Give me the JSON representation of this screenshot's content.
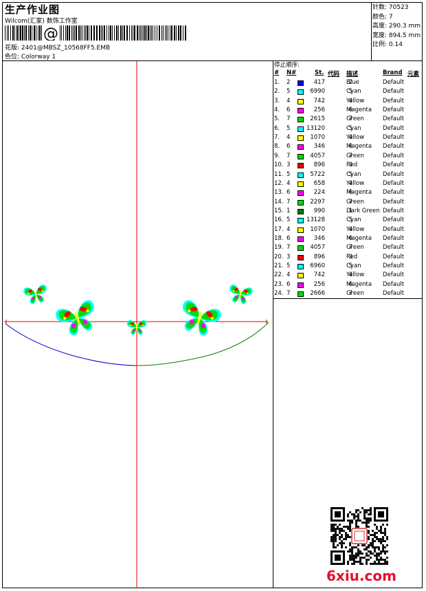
{
  "header": {
    "title": "生产作业图",
    "company": "Wilcom(汇家) 数饰工作室",
    "barcode_text": "@",
    "design_label": "花版:",
    "design_value": "2401@MBSZ_10568FF5.EMB",
    "colorway_label": "色位:",
    "colorway_value": "Colorway 1"
  },
  "stats": {
    "stitches": "针数: 70523",
    "colors": "颜色: 7",
    "height": "高度: 290.3 mm",
    "width": "宽度: 894.5 mm",
    "scale": "比例: 0.14"
  },
  "sequence": {
    "caption": "停止顺序:",
    "headers": {
      "num": "#",
      "needle": "N#",
      "st": "St.",
      "code": "代码",
      "desc": "描述",
      "brand": "Brand",
      "element": "元素"
    },
    "rows": [
      {
        "num": "1.",
        "needle": "2",
        "color": "#0000ff",
        "st": "417",
        "code": "2",
        "desc": "Blue",
        "brand": "Default"
      },
      {
        "num": "2.",
        "needle": "5",
        "color": "#00ffff",
        "st": "6990",
        "code": "5",
        "desc": "Cyan",
        "brand": "Default"
      },
      {
        "num": "3.",
        "needle": "4",
        "color": "#ffff00",
        "st": "742",
        "code": "4",
        "desc": "Yellow",
        "brand": "Default"
      },
      {
        "num": "4.",
        "needle": "6",
        "color": "#ff00ff",
        "st": "256",
        "code": "6",
        "desc": "Magenta",
        "brand": "Default"
      },
      {
        "num": "5.",
        "needle": "7",
        "color": "#00dd00",
        "st": "2615",
        "code": "7",
        "desc": "Green",
        "brand": "Default"
      },
      {
        "num": "6.",
        "needle": "5",
        "color": "#00ffff",
        "st": "13120",
        "code": "5",
        "desc": "Cyan",
        "brand": "Default"
      },
      {
        "num": "7.",
        "needle": "4",
        "color": "#ffff00",
        "st": "1070",
        "code": "4",
        "desc": "Yellow",
        "brand": "Default"
      },
      {
        "num": "8.",
        "needle": "6",
        "color": "#ff00ff",
        "st": "346",
        "code": "6",
        "desc": "Magenta",
        "brand": "Default"
      },
      {
        "num": "9.",
        "needle": "7",
        "color": "#00dd00",
        "st": "4057",
        "code": "7",
        "desc": "Green",
        "brand": "Default"
      },
      {
        "num": "10.",
        "needle": "3",
        "color": "#ff0000",
        "st": "896",
        "code": "3",
        "desc": "Red",
        "brand": "Default"
      },
      {
        "num": "11.",
        "needle": "5",
        "color": "#00ffff",
        "st": "5722",
        "code": "5",
        "desc": "Cyan",
        "brand": "Default"
      },
      {
        "num": "12.",
        "needle": "4",
        "color": "#ffff00",
        "st": "658",
        "code": "4",
        "desc": "Yellow",
        "brand": "Default"
      },
      {
        "num": "13.",
        "needle": "6",
        "color": "#ff00ff",
        "st": "224",
        "code": "6",
        "desc": "Magenta",
        "brand": "Default"
      },
      {
        "num": "14.",
        "needle": "7",
        "color": "#00dd00",
        "st": "2297",
        "code": "7",
        "desc": "Green",
        "brand": "Default"
      },
      {
        "num": "15.",
        "needle": "1",
        "color": "#008000",
        "st": "990",
        "code": "1",
        "desc": "Dark Green",
        "brand": "Default"
      },
      {
        "num": "16.",
        "needle": "5",
        "color": "#00ffff",
        "st": "13128",
        "code": "5",
        "desc": "Cyan",
        "brand": "Default"
      },
      {
        "num": "17.",
        "needle": "4",
        "color": "#ffff00",
        "st": "1070",
        "code": "4",
        "desc": "Yellow",
        "brand": "Default"
      },
      {
        "num": "18.",
        "needle": "6",
        "color": "#ff00ff",
        "st": "346",
        "code": "6",
        "desc": "Magenta",
        "brand": "Default"
      },
      {
        "num": "19.",
        "needle": "7",
        "color": "#00dd00",
        "st": "4057",
        "code": "7",
        "desc": "Green",
        "brand": "Default"
      },
      {
        "num": "20.",
        "needle": "3",
        "color": "#ff0000",
        "st": "896",
        "code": "3",
        "desc": "Red",
        "brand": "Default"
      },
      {
        "num": "21.",
        "needle": "5",
        "color": "#00ffff",
        "st": "6960",
        "code": "5",
        "desc": "Cyan",
        "brand": "Default"
      },
      {
        "num": "22.",
        "needle": "4",
        "color": "#ffff00",
        "st": "742",
        "code": "4",
        "desc": "Yellow",
        "brand": "Default"
      },
      {
        "num": "23.",
        "needle": "6",
        "color": "#ff00ff",
        "st": "256",
        "code": "6",
        "desc": "Magenta",
        "brand": "Default"
      },
      {
        "num": "24.",
        "needle": "7",
        "color": "#00dd00",
        "st": "2666",
        "code": "7",
        "desc": "Green",
        "brand": "Default"
      }
    ]
  },
  "watermark": {
    "text": "6xiu.com",
    "color": "#e60d2e"
  },
  "palette": {
    "crosshair": "#e00000",
    "arc_left": "#0000cc",
    "arc_right": "#008000"
  }
}
